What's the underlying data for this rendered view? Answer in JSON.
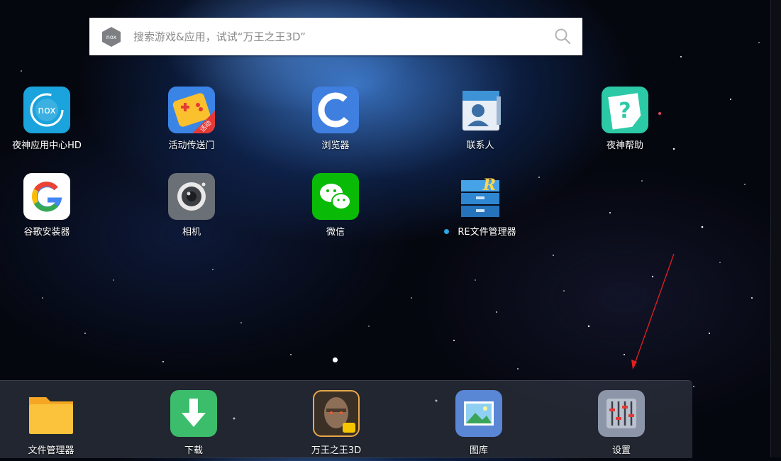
{
  "search": {
    "placeholder": "搜索游戏&应用，试试“万王之王3D”",
    "logo_icon": "nox-logo-icon",
    "search_icon": "magnifier-icon"
  },
  "apps": [
    {
      "label": "夜神应用中心HD",
      "icon": "nox-app-center-icon"
    },
    {
      "label": "活动传送门",
      "icon": "gamepad-event-icon",
      "badge": "活动"
    },
    {
      "label": "浏览器",
      "icon": "browser-icon"
    },
    {
      "label": "联系人",
      "icon": "contacts-icon"
    },
    {
      "label": "夜神帮助",
      "icon": "help-icon"
    },
    {
      "label": "谷歌安装器",
      "icon": "google-installer-icon"
    },
    {
      "label": "相机",
      "icon": "camera-icon"
    },
    {
      "label": "微信",
      "icon": "wechat-icon"
    },
    {
      "label": "RE文件管理器",
      "icon": "re-file-manager-icon",
      "new_indicator": true
    }
  ],
  "dock": [
    {
      "label": "文件管理器",
      "icon": "folder-icon"
    },
    {
      "label": "下载",
      "icon": "download-icon"
    },
    {
      "label": "万王之王3D",
      "icon": "game-king-of-kings-icon"
    },
    {
      "label": "图库",
      "icon": "gallery-icon"
    },
    {
      "label": "设置",
      "icon": "settings-sliders-icon"
    }
  ],
  "pager": {
    "current_page": 1,
    "total_pages": 1
  },
  "colors": {
    "accent": "#27a9e6",
    "annotation_arrow": "#e02020"
  }
}
